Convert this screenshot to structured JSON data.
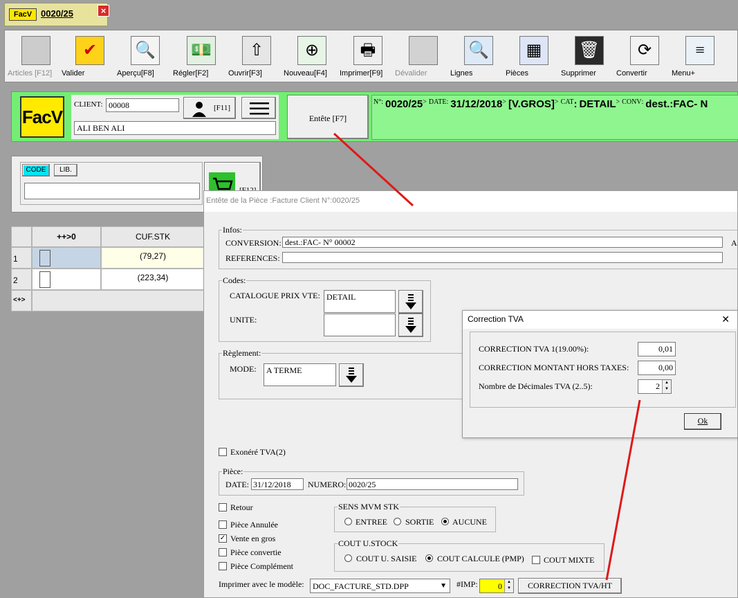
{
  "doc_tab": {
    "logo": "FacV",
    "title": "0020/25",
    "close": "×"
  },
  "toolbar": [
    {
      "key": "articles",
      "label": "Articles [F12]",
      "icon": "blank-icon",
      "glyph": "",
      "bg": "#cccccc",
      "disabled": true
    },
    {
      "key": "valider",
      "label": "Valider",
      "icon": "checkmark-icon",
      "glyph": "✔",
      "bg": "#ffd21a",
      "disabled": false
    },
    {
      "key": "apercu",
      "label": "Aperçu[F8]",
      "icon": "magnifier-icon",
      "glyph": "🔍",
      "bg": "#f4f4f4",
      "disabled": false
    },
    {
      "key": "regler",
      "label": "Régler[F2]",
      "icon": "money-icon",
      "glyph": "💵",
      "bg": "#e2f0e2",
      "disabled": false
    },
    {
      "key": "ouvrir",
      "label": "Ouvrir[F3]",
      "icon": "up-arrow-icon",
      "glyph": "⇧",
      "bg": "#e6e6e6",
      "disabled": false
    },
    {
      "key": "nouveau",
      "label": "Nouveau[F4]",
      "icon": "add-icon",
      "glyph": "⊕",
      "bg": "#e6f5e6",
      "disabled": false
    },
    {
      "key": "imprimer",
      "label": "Imprimer[F9]",
      "icon": "printer-icon",
      "glyph": "🖶",
      "bg": "#eeeeee",
      "disabled": false
    },
    {
      "key": "devalider",
      "label": "Dévalider",
      "icon": "blank-icon",
      "glyph": "",
      "bg": "#d2d2d2",
      "disabled": true
    },
    {
      "key": "lignes",
      "label": "Lignes",
      "icon": "search-lines-icon",
      "glyph": "🔍",
      "bg": "#dde9f7",
      "disabled": false
    },
    {
      "key": "pieces",
      "label": "Pièces",
      "icon": "pieces-icon",
      "glyph": "▦",
      "bg": "#dde5f7",
      "disabled": false
    },
    {
      "key": "supprimer",
      "label": "Supprimer",
      "icon": "trash-icon",
      "glyph": "🗑",
      "bg": "#2a2a2a",
      "disabled": false
    },
    {
      "key": "convertir",
      "label": "Convertir",
      "icon": "convert-icon",
      "glyph": "⟳",
      "bg": "#f2f2f2",
      "disabled": false
    },
    {
      "key": "menu",
      "label": "Menu+",
      "icon": "menu-icon",
      "glyph": "≡",
      "bg": "#eaf2f7",
      "disabled": false
    }
  ],
  "header": {
    "logo": "FacV",
    "client_label": "CLIENT:",
    "client_code": "00008",
    "client_name": "ALI BEN ALI",
    "f11": "[F11]",
    "entete": "Entête [F7]",
    "num_k": "N°",
    "num_v": "0020/25",
    "date_k": "DATE",
    "date_v": "31/12/2018",
    "gros_v": "[V.GROS]",
    "cat_k": "CAT",
    "cat_v": "DETAIL",
    "conv_k": "CONV",
    "conv_v": "dest.:FAC- N"
  },
  "search": {
    "code": "CODE",
    "lib": "LIB.",
    "value": "",
    "f12": "[F12]"
  },
  "grid": {
    "col_b": "++>0",
    "col_c": "CUF.STK",
    "rows": [
      {
        "num": "1",
        "val": "(79,27)"
      },
      {
        "num": "2",
        "val": "(223,34)"
      }
    ],
    "nav": "<+>"
  },
  "main_dialog": {
    "title": "Entête de la Pièce :Facture Client N°:0020/25",
    "infos": {
      "legend": "Infos:",
      "conversion_label": "CONVERSION:",
      "conversion_value": "dest.:FAC- N° 00002",
      "references_label": "REFERENCES:",
      "references_value": "",
      "trailing": "A"
    },
    "codes": {
      "legend": "Codes:",
      "catalogue_label": "CATALOGUE PRIX VTE:",
      "catalogue_value": "DETAIL",
      "unite_label": "UNITE:",
      "unite_value": ""
    },
    "reglement": {
      "legend": "Règlement:",
      "mode_label": "MODE:",
      "mode_value": "A TERME"
    },
    "exonere": {
      "label": "Exonéré TVA(2)",
      "checked": false
    },
    "piece": {
      "legend": "Pièce:",
      "date_label": "DATE:",
      "date_value": "31/12/2018",
      "numero_label": "NUMERO:",
      "numero_value": "0020/25"
    },
    "checks": [
      {
        "label": "Retour",
        "checked": false
      },
      {
        "label": "Pièce Annulée",
        "checked": false
      },
      {
        "label": "Vente en gros",
        "checked": true
      },
      {
        "label": "Pièce convertie",
        "checked": false
      },
      {
        "label": "Pièce Complément",
        "checked": false
      }
    ],
    "sens": {
      "legend": "SENS MVM STK",
      "options": [
        {
          "label": "ENTREE",
          "selected": false
        },
        {
          "label": "SORTIE",
          "selected": false
        },
        {
          "label": "AUCUNE",
          "selected": true
        }
      ]
    },
    "cout": {
      "legend": "COUT U.STOCK",
      "options": [
        {
          "label": "COUT U. SAISIE",
          "selected": false
        },
        {
          "label": "COUT CALCULE (PMP)",
          "selected": true
        }
      ],
      "mixte_label": "COUT MIXTE",
      "mixte_checked": false
    },
    "imprimer_label": "Imprimer avec le modèle:",
    "modele_value": "DOC_FACTURE_STD.DPP",
    "imp_label": "#IMP:",
    "imp_value": "0",
    "correction_button": "CORRECTION TVA/HT"
  },
  "correction_dialog": {
    "title": "Correction TVA",
    "close": "✕",
    "rows": [
      {
        "label": "CORRECTION TVA  1(19.00%):",
        "value": "0,01"
      },
      {
        "label": "CORRECTION MONTANT HORS TAXES:",
        "value": "0,00"
      },
      {
        "label": "Nombre de Décimales TVA (2..5):",
        "value": "2"
      }
    ],
    "ok": "Ok"
  },
  "colors": {
    "header_green": "#73ee73",
    "info_green": "#8ff58f",
    "logo_yellow": "#ffea00",
    "arrow_red": "#e01818",
    "imp_yellow": "#ffff00",
    "code_cyan": "#00e5f5"
  }
}
